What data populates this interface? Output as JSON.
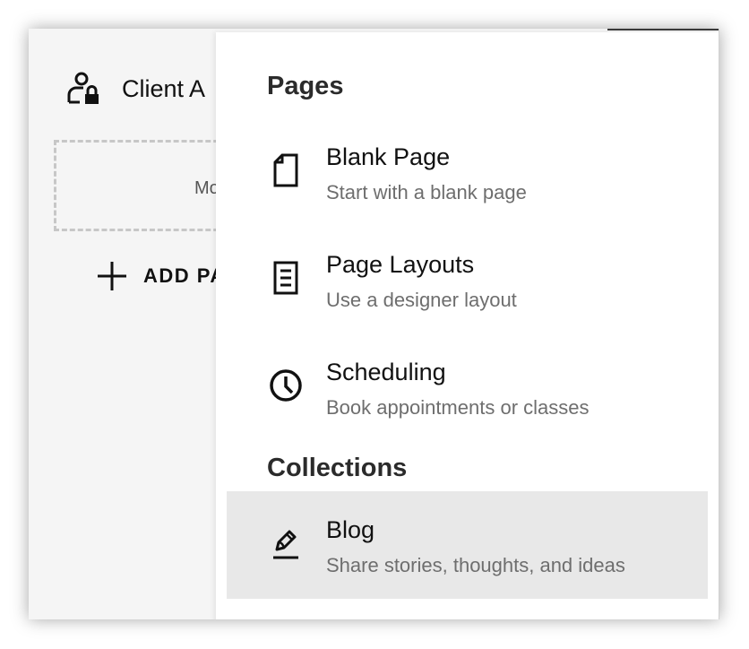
{
  "left_panel": {
    "nav_item_label": "Client A",
    "dashed_box_text": "Mo",
    "add_page_label": "ADD PA"
  },
  "menu": {
    "sections": [
      {
        "title": "Pages",
        "items": [
          {
            "title": "Blank Page",
            "subtitle": "Start with a blank page",
            "icon": "blank-page-icon"
          },
          {
            "title": "Page Layouts",
            "subtitle": "Use a designer layout",
            "icon": "page-layout-icon"
          },
          {
            "title": "Scheduling",
            "subtitle": "Book appointments or classes",
            "icon": "clock-icon"
          }
        ]
      },
      {
        "title": "Collections",
        "items": [
          {
            "title": "Blog",
            "subtitle": "Share stories, thoughts, and ideas",
            "icon": "blog-pen-icon",
            "highlighted": true
          }
        ]
      }
    ]
  },
  "colors": {
    "highlight": "#e8e8e8",
    "panel_bg": "#f5f5f5",
    "text_primary": "#111111",
    "text_secondary": "#6e6e6e"
  }
}
